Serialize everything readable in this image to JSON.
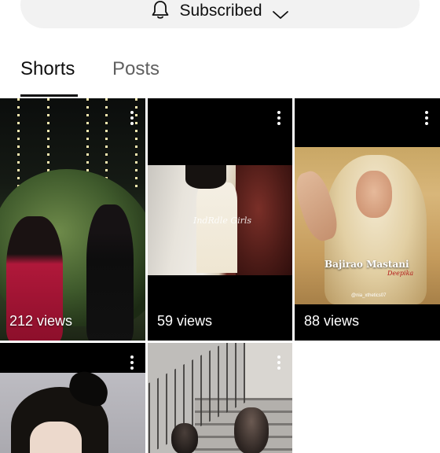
{
  "subscribe": {
    "label": "Subscribed",
    "icon_left": "bell-icon",
    "icon_right": "chevron-down-icon"
  },
  "tabs": [
    {
      "label": "Shorts",
      "selected": true
    },
    {
      "label": "Posts",
      "selected": false
    }
  ],
  "shorts": [
    {
      "views": "212 views"
    },
    {
      "views": "59 views",
      "watermark": "IndRdle Girls"
    },
    {
      "views": "88 views",
      "overlay_title": "Bajirao Mastani",
      "overlay_subtitle": "Deepika",
      "overlay_handle": "@nia_xthetics07"
    },
    {
      "views": ""
    },
    {
      "views": ""
    }
  ],
  "colors": {
    "background": "#ffffff",
    "pill": "#f2f2f2",
    "text_primary": "#0f0f0f",
    "text_secondary": "#606060"
  }
}
